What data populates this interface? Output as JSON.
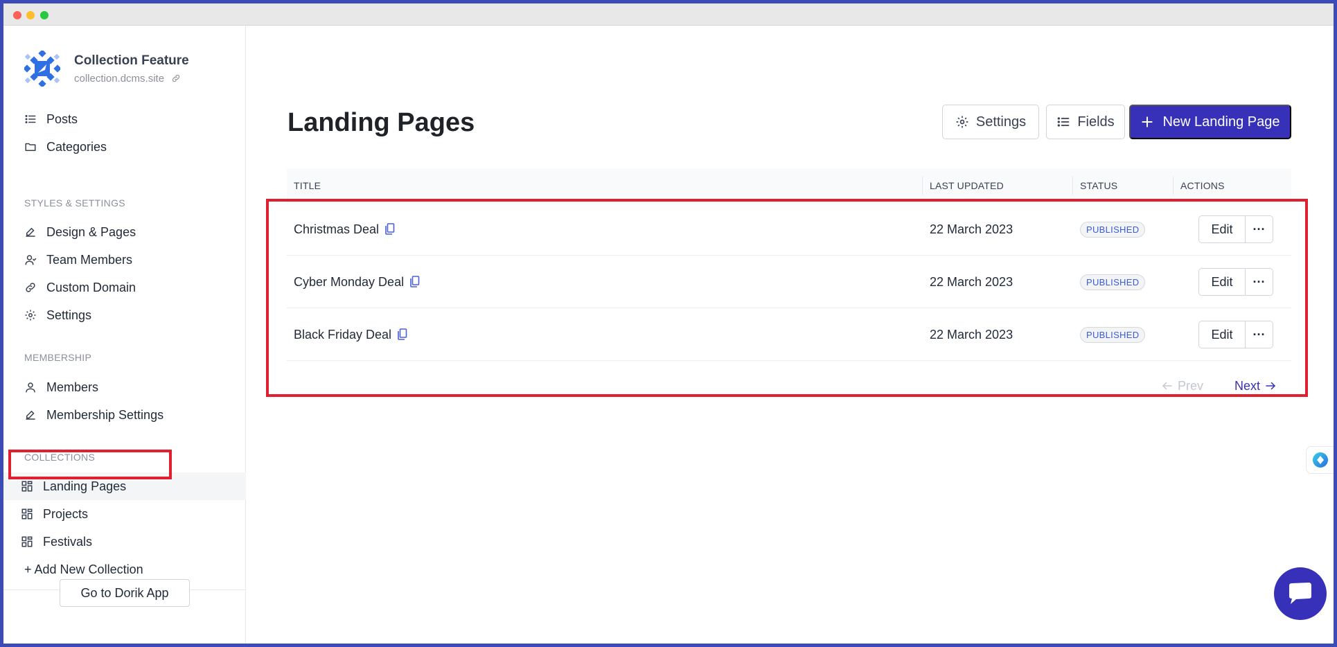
{
  "brand": {
    "name": "Collection Feature",
    "url": "collection.dcms.site"
  },
  "sidebar": {
    "top_items": [
      {
        "label": "Posts",
        "icon": "list-icon"
      },
      {
        "label": "Categories",
        "icon": "folder-icon"
      }
    ],
    "styles_section": "STYLES & SETTINGS",
    "styles_items": [
      {
        "label": "Design & Pages",
        "icon": "pen-icon"
      },
      {
        "label": "Team Members",
        "icon": "user-group-icon"
      },
      {
        "label": "Custom Domain",
        "icon": "link-icon"
      },
      {
        "label": "Settings",
        "icon": "gear-icon"
      }
    ],
    "membership_section": "MEMBERSHIP",
    "membership_items": [
      {
        "label": "Members",
        "icon": "user-icon"
      },
      {
        "label": "Membership Settings",
        "icon": "pen-icon"
      }
    ],
    "collections_section": "COLLECTIONS",
    "collection_items": [
      {
        "label": "Landing Pages",
        "icon": "grid-icon",
        "active": true
      },
      {
        "label": "Projects",
        "icon": "grid-icon"
      },
      {
        "label": "Festivals",
        "icon": "grid-icon"
      }
    ],
    "add_collection": "+ Add New Collection",
    "footer_button": "Go to Dorik App"
  },
  "main": {
    "title": "Landing Pages",
    "settings_button": "Settings",
    "fields_button": "Fields",
    "new_button": "New Landing Page",
    "table": {
      "headers": [
        "TITLE",
        "LAST UPDATED",
        "STATUS",
        "ACTIONS"
      ],
      "rows": [
        {
          "title": "Christmas Deal",
          "updated": "22 March 2023",
          "status": "PUBLISHED",
          "edit": "Edit",
          "more": "···"
        },
        {
          "title": "Cyber Monday Deal",
          "updated": "22 March 2023",
          "status": "PUBLISHED",
          "edit": "Edit",
          "more": "···"
        },
        {
          "title": "Black Friday Deal",
          "updated": "22 March 2023",
          "status": "PUBLISHED",
          "edit": "Edit",
          "more": "···"
        }
      ]
    },
    "pager": {
      "prev": "Prev",
      "next": "Next"
    }
  },
  "colors": {
    "accent": "#3730b8",
    "highlight": "#e0202e",
    "badge_text": "#3b5bdb",
    "window_border": "#3b4cb8"
  }
}
